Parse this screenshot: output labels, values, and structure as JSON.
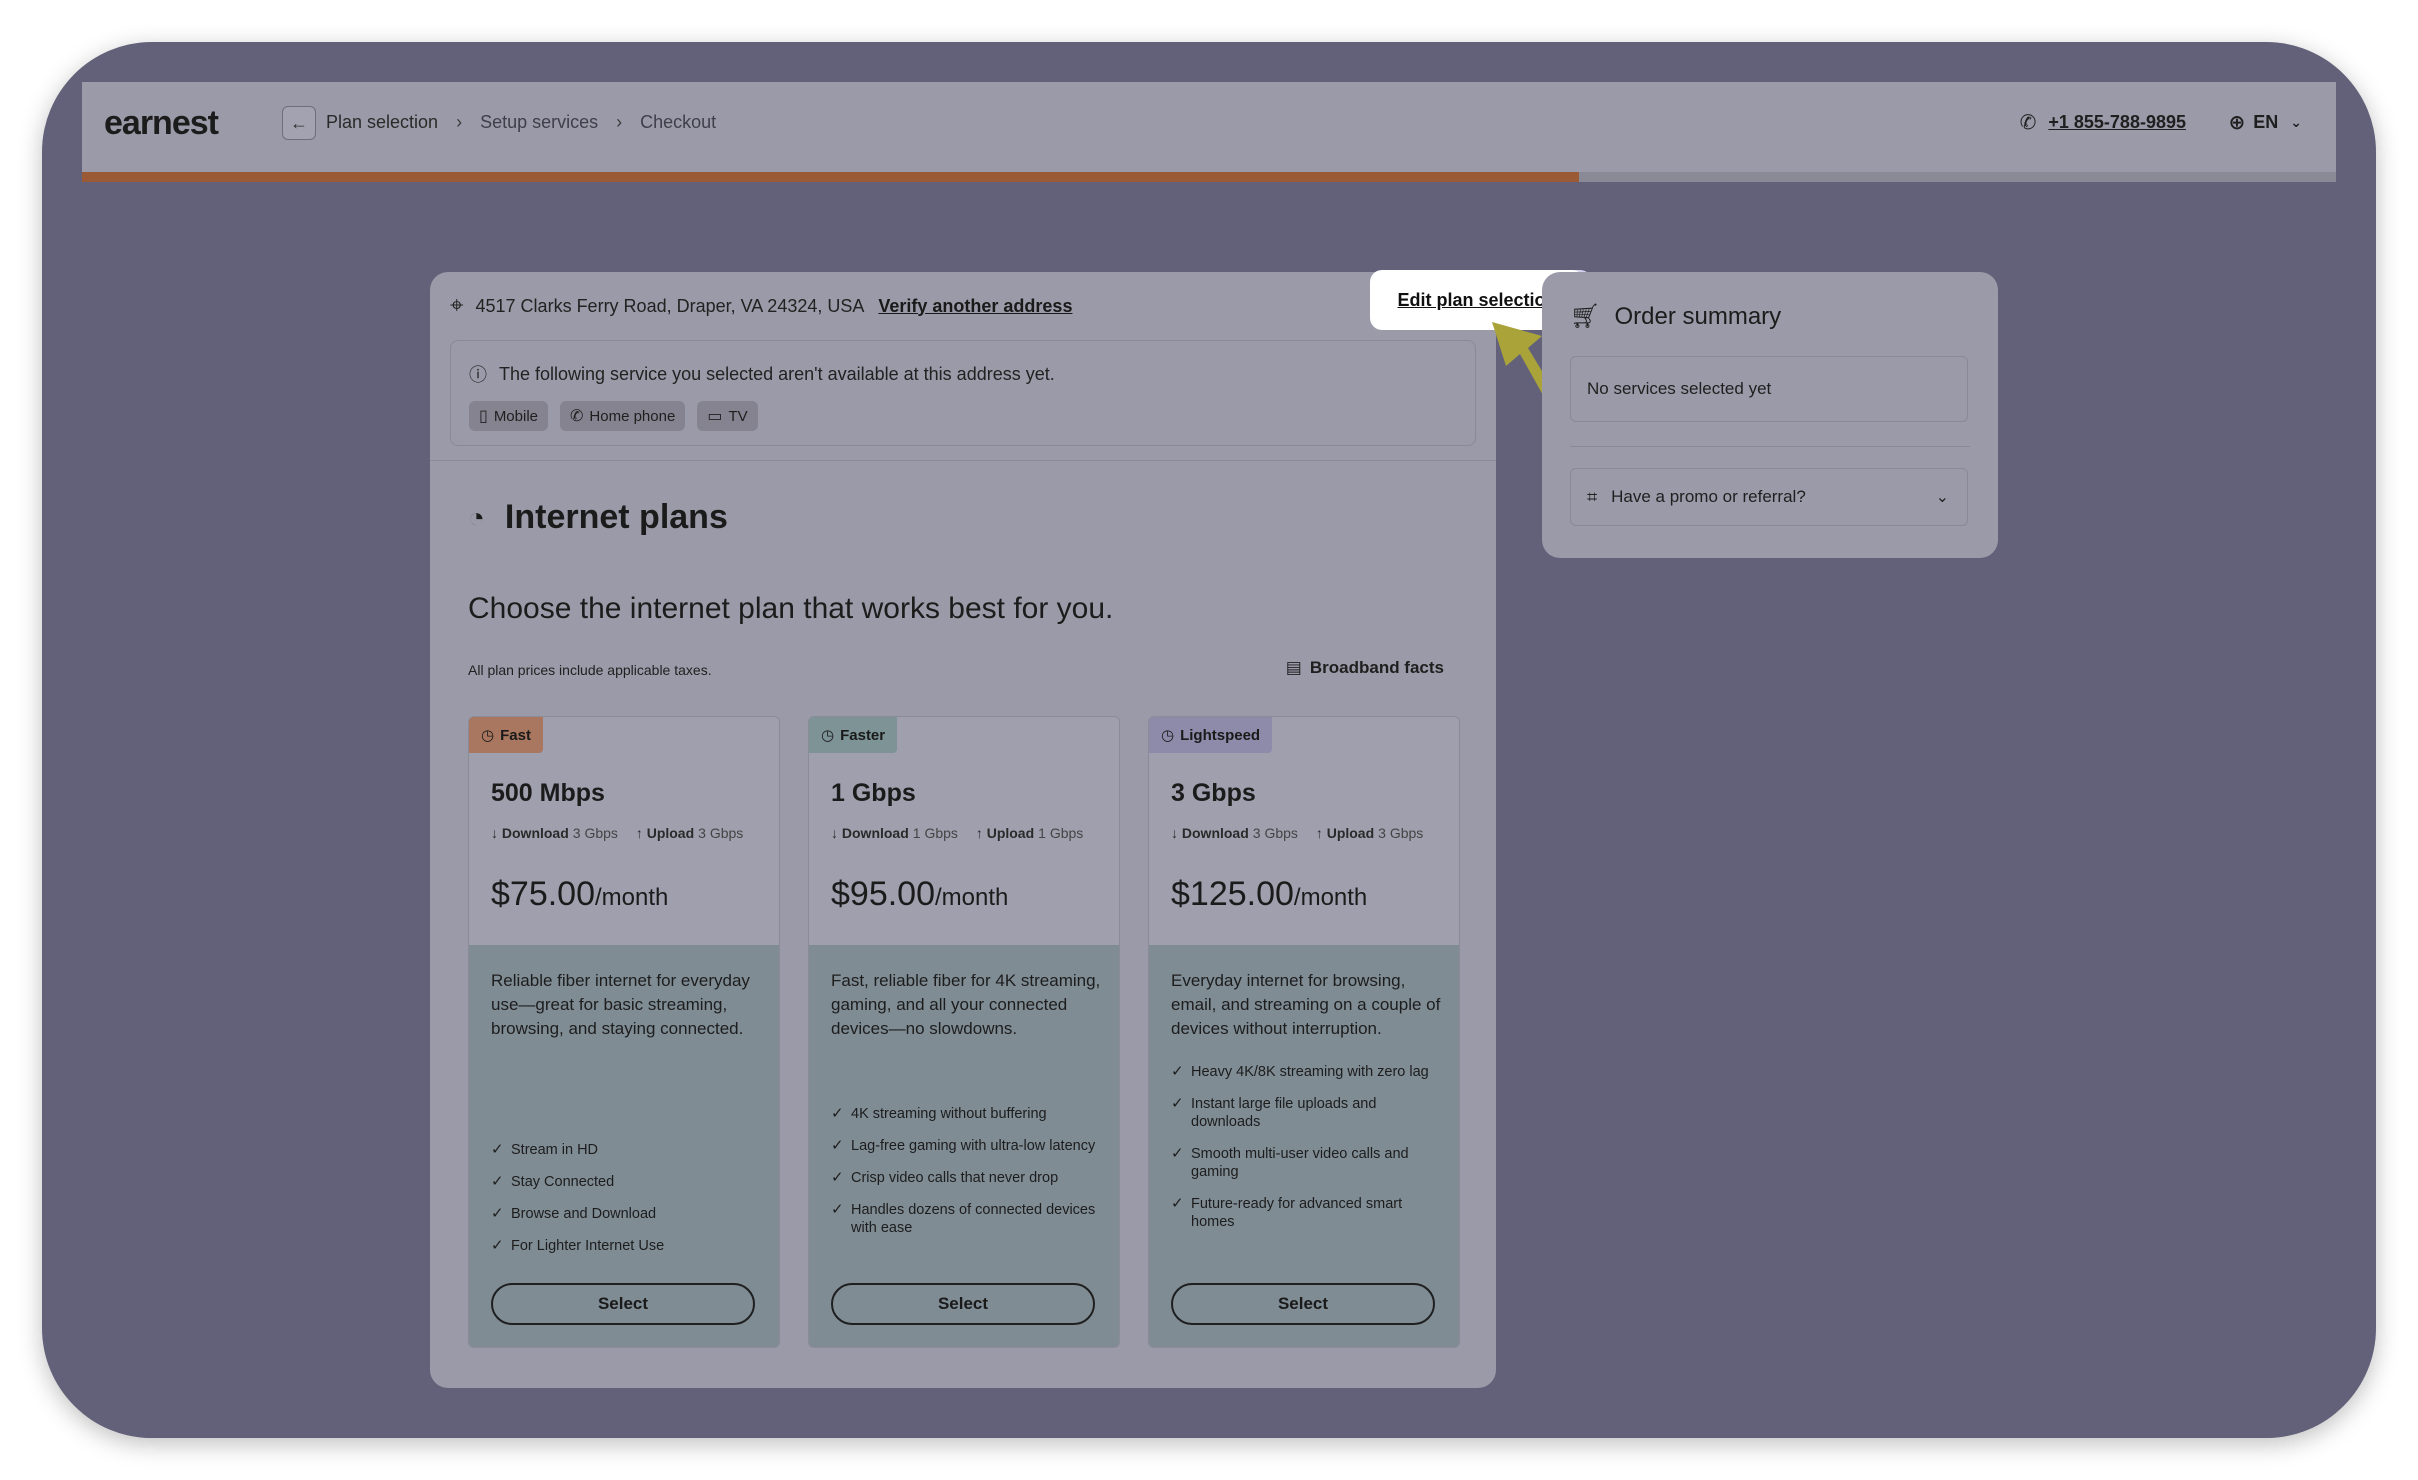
{
  "header": {
    "logo": "earnest",
    "breadcrumbs": [
      "Plan selection",
      "Setup services",
      "Checkout"
    ],
    "phone": "+1 855-788-9895",
    "language": "EN",
    "progress": 0.664
  },
  "address": {
    "text": "4517 Clarks Ferry Road, Draper, VA 24324, USA",
    "verify_link": "Verify another address",
    "edit_link": "Edit plan selection"
  },
  "notice": {
    "message": "The following service you selected aren't available at this address yet.",
    "chips": [
      {
        "label": "Mobile",
        "icon": "mobile-icon"
      },
      {
        "label": "Home phone",
        "icon": "phone-icon"
      },
      {
        "label": "TV",
        "icon": "tv-icon"
      }
    ]
  },
  "section": {
    "title": "Internet plans",
    "subtitle": "Choose the internet plan that works best for you.",
    "taxes_note": "All plan prices include applicable taxes.",
    "broadband_facts": "Broadband facts"
  },
  "plans": [
    {
      "badge": "Fast",
      "badge_color": "#a9775f",
      "speed": "500 Mbps",
      "download_label": "Download",
      "download": "3 Gbps",
      "upload_label": "Upload",
      "upload": "3 Gbps",
      "price": "$75.00",
      "per": "/month",
      "description": "Reliable fiber internet for everyday use—great for basic streaming, browsing, and staying connected.",
      "features": [
        "Stream in HD",
        "Stay Connected",
        "Browse and Download",
        "For Lighter Internet Use"
      ],
      "select": "Select"
    },
    {
      "badge": "Faster",
      "badge_color": "#7d9395",
      "speed": "1 Gbps",
      "download_label": "Download",
      "download": "1 Gbps",
      "upload_label": "Upload",
      "upload": "1 Gbps",
      "price": "$95.00",
      "per": "/month",
      "description": "Fast, reliable fiber for 4K streaming, gaming, and all your connected devices—no slowdowns.",
      "features": [
        "4K streaming without buffering",
        "Lag-free gaming with ultra-low latency",
        "Crisp video calls that never drop",
        "Handles dozens of connected devices with ease"
      ],
      "select": "Select"
    },
    {
      "badge": "Lightspeed",
      "badge_color": "#8e8aaa",
      "speed": "3 Gbps",
      "download_label": "Download",
      "download": "3 Gbps",
      "upload_label": "Upload",
      "upload": "3 Gbps",
      "price": "$125.00",
      "per": "/month",
      "description": "Everyday internet for browsing, email, and streaming on a couple of devices without interruption.",
      "features": [
        "Heavy 4K/8K streaming with zero lag",
        "Instant large file uploads and downloads",
        "Smooth multi-user video calls and gaming",
        "Future-ready for advanced smart homes"
      ],
      "select": "Select"
    }
  ],
  "summary": {
    "title": "Order summary",
    "empty": "No services selected yet",
    "promo": "Have a promo or referral?"
  },
  "colors": {
    "accent_progress": "#9a5a35",
    "overlay": "#626179",
    "pointer_arrow": "#a9a33a"
  }
}
